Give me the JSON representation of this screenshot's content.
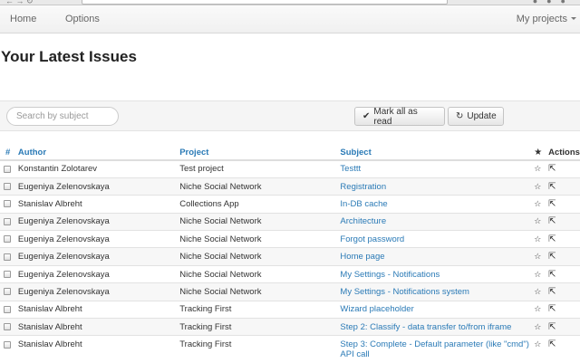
{
  "navbar": {
    "home": "Home",
    "options": "Options",
    "projects": "My projects"
  },
  "page": {
    "title": "Your Latest Issues"
  },
  "toolbar": {
    "search_placeholder": "Search by subject",
    "mark_all_label": "Mark all as read",
    "update_label": "Update"
  },
  "table": {
    "headers": {
      "num": "#",
      "author": "Author",
      "project": "Project",
      "subject": "Subject",
      "star": "★",
      "actions": "Actions"
    },
    "rows": [
      {
        "author": "Konstantin Zolotarev",
        "project": "Test project",
        "subject": "Testtt"
      },
      {
        "author": "Eugeniya Zelenovskaya",
        "project": "Niche Social Network",
        "subject": "Registration"
      },
      {
        "author": "Stanislav Albreht",
        "project": "Collections App",
        "subject": "In-DB cache"
      },
      {
        "author": "Eugeniya Zelenovskaya",
        "project": "Niche Social Network",
        "subject": "Architecture"
      },
      {
        "author": "Eugeniya Zelenovskaya",
        "project": "Niche Social Network",
        "subject": "Forgot password"
      },
      {
        "author": "Eugeniya Zelenovskaya",
        "project": "Niche Social Network",
        "subject": "Home page"
      },
      {
        "author": "Eugeniya Zelenovskaya",
        "project": "Niche Social Network",
        "subject": "My Settings - Notifications"
      },
      {
        "author": "Eugeniya Zelenovskaya",
        "project": "Niche Social Network",
        "subject": "My Settings - Notifications system"
      },
      {
        "author": "Stanislav Albreht",
        "project": "Tracking First",
        "subject": "Wizard placeholder"
      },
      {
        "author": "Stanislav Albreht",
        "project": "Tracking First",
        "subject": "Step 2: Classify - data transfer to/from iframe"
      },
      {
        "author": "Stanislav Albreht",
        "project": "Tracking First",
        "subject": "Step 3: Complete - Default parameter (like \"cmd\") API call"
      }
    ]
  },
  "icons": {
    "star": "star-icon",
    "action": "share-icon",
    "mark_all": "checkmark-icon",
    "update": "refresh-icon"
  },
  "colors": {
    "link": "#2a7ab6",
    "toolbar_bg": "#f5f5f5"
  }
}
